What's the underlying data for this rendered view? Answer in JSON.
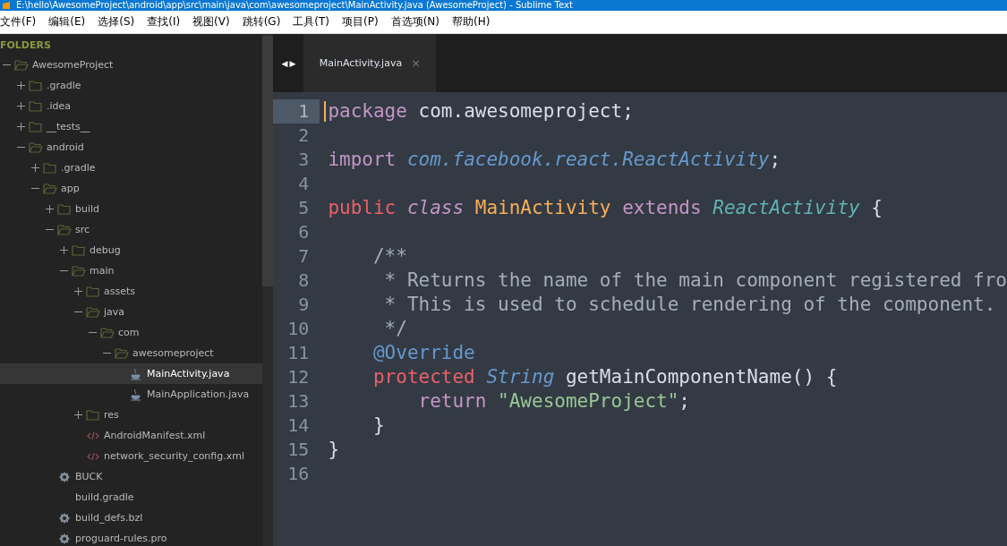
{
  "window": {
    "title": "E:\\hello\\AwesomeProject\\android\\app\\src\\main\\java\\com\\awesomeproject\\MainActivity.java (AwesomeProject) - Sublime Text"
  },
  "menu": [
    "文件(F)",
    "编辑(E)",
    "选择(S)",
    "查找(I)",
    "视图(V)",
    "跳转(G)",
    "工具(T)",
    "项目(P)",
    "首选项(N)",
    "帮助(H)"
  ],
  "sidebar": {
    "heading": "FOLDERS",
    "tree": [
      {
        "label": "AwesomeProject",
        "kind": "folder",
        "expanded": true,
        "children": [
          {
            "label": ".gradle",
            "kind": "folder",
            "expanded": false
          },
          {
            "label": ".idea",
            "kind": "folder",
            "expanded": false
          },
          {
            "label": "__tests__",
            "kind": "folder",
            "expanded": false
          },
          {
            "label": "android",
            "kind": "folder",
            "expanded": true,
            "children": [
              {
                "label": ".gradle",
                "kind": "folder",
                "expanded": false
              },
              {
                "label": "app",
                "kind": "folder",
                "expanded": true,
                "children": [
                  {
                    "label": "build",
                    "kind": "folder",
                    "expanded": false
                  },
                  {
                    "label": "src",
                    "kind": "folder",
                    "expanded": true,
                    "children": [
                      {
                        "label": "debug",
                        "kind": "folder",
                        "expanded": false
                      },
                      {
                        "label": "main",
                        "kind": "folder",
                        "expanded": true,
                        "children": [
                          {
                            "label": "assets",
                            "kind": "folder",
                            "expanded": false
                          },
                          {
                            "label": "java",
                            "kind": "folder",
                            "expanded": true,
                            "children": [
                              {
                                "label": "com",
                                "kind": "folder",
                                "expanded": true,
                                "children": [
                                  {
                                    "label": "awesomeproject",
                                    "kind": "folder",
                                    "expanded": true,
                                    "children": [
                                      {
                                        "label": "MainActivity.java",
                                        "kind": "java",
                                        "selected": true
                                      },
                                      {
                                        "label": "MainApplication.java",
                                        "kind": "java",
                                        "selected": false
                                      }
                                    ]
                                  }
                                ]
                              }
                            ]
                          },
                          {
                            "label": "res",
                            "kind": "folder",
                            "expanded": false
                          },
                          {
                            "label": "AndroidManifest.xml",
                            "kind": "xml",
                            "selected": false
                          },
                          {
                            "label": "network_security_config.xml",
                            "kind": "xml",
                            "selected": false
                          }
                        ]
                      }
                    ]
                  },
                  {
                    "label": "BUCK",
                    "kind": "gear",
                    "selected": false
                  },
                  {
                    "label": "build.gradle",
                    "kind": "plain",
                    "selected": false
                  },
                  {
                    "label": "build_defs.bzl",
                    "kind": "gear",
                    "selected": false
                  },
                  {
                    "label": "proguard-rules.pro",
                    "kind": "gear",
                    "selected": false
                  }
                ]
              }
            ]
          }
        ]
      }
    ]
  },
  "tabs": [
    {
      "label": "MainActivity.java",
      "selected": true,
      "close": "×"
    }
  ],
  "tab_nav": {
    "left": "◀",
    "right": "▶"
  },
  "editor": {
    "lines": [
      {
        "number": "1",
        "selected": true,
        "tokens": [
          {
            "kind": "keyword",
            "text": "package"
          },
          {
            "kind": "plain",
            "text": " com.awesomeproject;"
          }
        ]
      },
      {
        "number": "2",
        "selected": false
      },
      {
        "number": "3",
        "selected": false,
        "tokens": [
          {
            "kind": "keyword",
            "text": "import "
          },
          {
            "kind": "import",
            "text": "com.facebook.react.ReactActivity"
          },
          {
            "kind": "plain",
            "text": ";"
          }
        ]
      },
      {
        "number": "4",
        "selected": false
      },
      {
        "number": "5",
        "selected": false,
        "tokens": [
          {
            "kind": "modifier",
            "text": "public "
          },
          {
            "kind": "storage",
            "text": "class "
          },
          {
            "kind": "classname",
            "text": "MainActivity "
          },
          {
            "kind": "keyword",
            "text": "extends "
          },
          {
            "kind": "supertype",
            "text": "ReactActivity"
          },
          {
            "kind": "plain",
            "text": " {"
          }
        ]
      },
      {
        "number": "6",
        "selected": false
      },
      {
        "number": "7",
        "selected": false,
        "tokens": [
          {
            "kind": "comment",
            "text": "    /**"
          }
        ]
      },
      {
        "number": "8",
        "selected": false,
        "tokens": [
          {
            "kind": "comment",
            "text": "     * Returns the name of the main component registered fro"
          }
        ]
      },
      {
        "number": "9",
        "selected": false,
        "tokens": [
          {
            "kind": "comment",
            "text": "     * This is used to schedule rendering of the component."
          }
        ]
      },
      {
        "number": "10",
        "selected": false,
        "tokens": [
          {
            "kind": "comment",
            "text": "     */"
          }
        ]
      },
      {
        "number": "11",
        "selected": false,
        "tokens": [
          {
            "kind": "annotation",
            "text": "    @Override"
          }
        ]
      },
      {
        "number": "12",
        "selected": false,
        "tokens": [
          {
            "kind": "modifier",
            "text": "    protected "
          },
          {
            "kind": "type",
            "text": "String"
          },
          {
            "kind": "plain",
            "text": " getMainComponentName() {"
          }
        ]
      },
      {
        "number": "13",
        "selected": false,
        "tokens": [
          {
            "kind": "keyword",
            "text": "        return "
          },
          {
            "kind": "string",
            "text": "\"AwesomeProject\""
          },
          {
            "kind": "plain",
            "text": ";"
          }
        ]
      },
      {
        "number": "14",
        "selected": false,
        "tokens": [
          {
            "kind": "plain",
            "text": "    }"
          }
        ]
      },
      {
        "number": "15",
        "selected": false,
        "tokens": [
          {
            "kind": "plain",
            "text": "}"
          }
        ]
      },
      {
        "number": "16",
        "selected": false
      }
    ]
  }
}
